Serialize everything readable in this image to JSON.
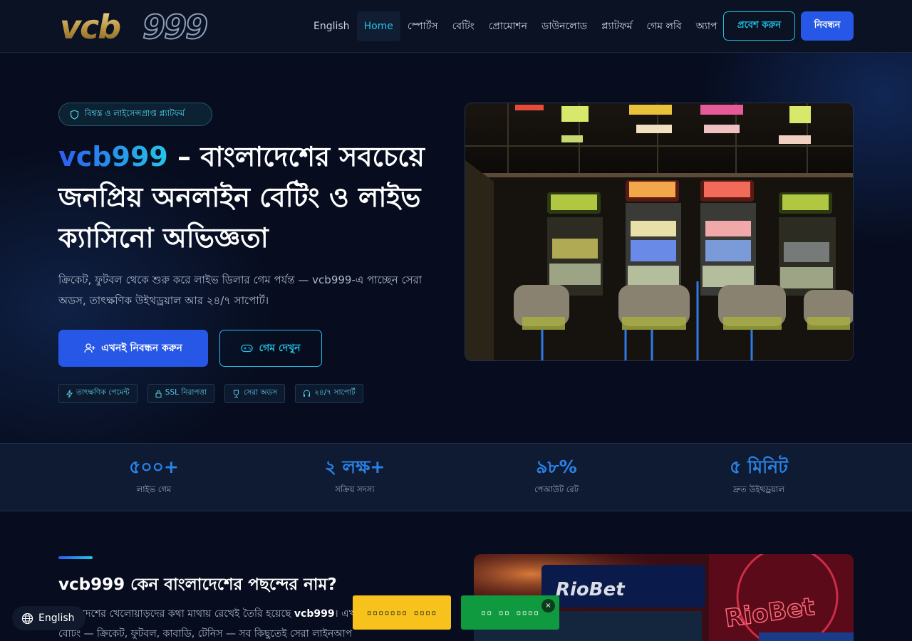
{
  "header": {
    "logo_text": "vcb999",
    "nav": [
      "English",
      "Home",
      "স্পোর্টস",
      "বেটিং",
      "প্রোমোশন",
      "ডাউনলোড",
      "প্ল্যাটফর্ম",
      "গেম লবি",
      "অ্যাপ"
    ],
    "active_nav": "Home",
    "login_label": "প্রবেশ করুন",
    "register_label": "নিবন্ধন"
  },
  "hero": {
    "badge": "বিশ্বস্ত ও লাইসেন্সপ্রাপ্ত প্ল্যাটফর্ম",
    "title_brand": "vcb999",
    "title_rest": " – বাংলাদেশের সবচেয়ে জনপ্রিয় অনলাইন বেটিং ও লাইভ ক্যাসিনো অভিজ্ঞতা",
    "description": "ক্রিকেট, ফুটবল থেকে শুরু করে লাইভ ডিলার গেম পর্যন্ত — vcb999-এ পাচ্ছেন সেরা অডস, তাৎক্ষণিক উইথড্রয়াল আর ২৪/৭ সাপোর্ট।",
    "cta_primary": "এখনই নিবন্ধন করুন",
    "cta_secondary": "গেম দেখুন",
    "chips": [
      "তাৎক্ষণিক পেমেন্ট",
      "SSL নিরাপত্তা",
      "সেরা অডস",
      "২৪/৭ সাপোর্ট"
    ]
  },
  "stats": [
    {
      "value": "৫০০+",
      "label": "লাইভ গেম"
    },
    {
      "value": "২ লক্ষ+",
      "label": "সক্রিয় সদস্য"
    },
    {
      "value": "৯৮%",
      "label": "পেআউট রেট"
    },
    {
      "value": "৫ মিনিট",
      "label": "দ্রুত উইথড্রয়াল"
    }
  ],
  "section": {
    "title": "vcb999 কেন বাংলাদেশের পছন্দের নাম?",
    "text_pre": "বাংলাদেশের খেলোয়াড়দের কথা মাথায় রেখেই তৈরি হয়েছে ",
    "text_brand": "vcb999",
    "text_post": "। এখানে বিশ্বমানের স্পোর্টস বেটিং — ক্রিকেট, ফুটবল, কাবাডি, টেনিস — সব কিছুতেই সেরা লাইনআপ"
  },
  "floating": {
    "language_label": "English",
    "yellow_button": "▫▫▫▫▫▫▫ ▫▫▫▫",
    "green_button": "▫▫ ▫▫ ▫▫▫▫",
    "close_symbol": "×"
  },
  "icons": [
    "globe-icon",
    "shield-icon",
    "user-plus-icon",
    "gamepad-icon",
    "lightning-icon",
    "lock-icon",
    "trophy-icon",
    "headset-icon",
    "close-icon"
  ],
  "colors": {
    "accent_blue": "#2657e6",
    "accent_cyan": "#22c1e6",
    "background": "#070d1f"
  }
}
